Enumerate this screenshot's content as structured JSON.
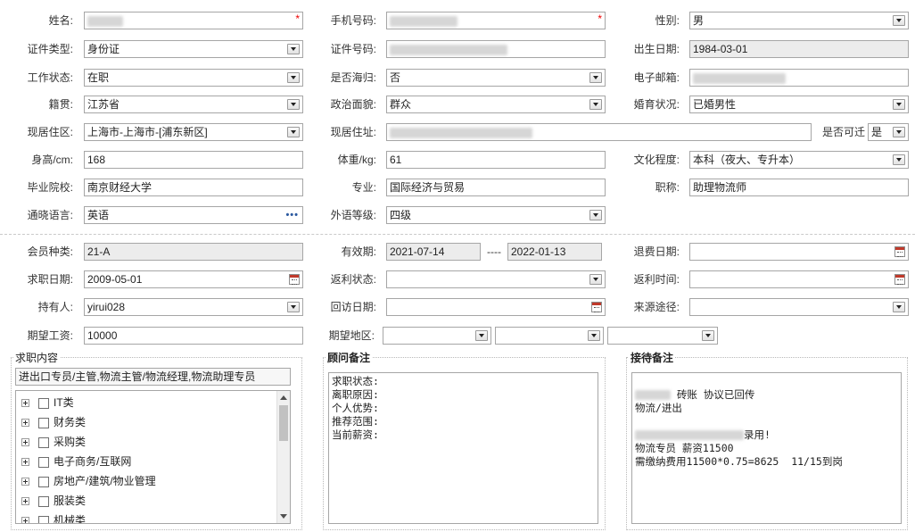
{
  "personal": {
    "name": {
      "label": "姓名:"
    },
    "mobile": {
      "label": "手机号码:"
    },
    "gender": {
      "label": "性别:",
      "value": "男"
    },
    "id_type": {
      "label": "证件类型:",
      "value": "身份证"
    },
    "id_number": {
      "label": "证件号码:"
    },
    "birth_date": {
      "label": "出生日期:",
      "value": "1984-03-01"
    },
    "work_status": {
      "label": "工作状态:",
      "value": "在职"
    },
    "overseas_returnee": {
      "label": "是否海归:",
      "value": "否"
    },
    "email": {
      "label": "电子邮箱:"
    },
    "native_place": {
      "label": "籍贯:",
      "value": "江苏省"
    },
    "political_status": {
      "label": "政治面貌:",
      "value": "群众"
    },
    "marital_status": {
      "label": "婚育状况:",
      "value": "已婚男性"
    },
    "residence_area": {
      "label": "现居住区:",
      "value": "上海市-上海市-[浦东新区]"
    },
    "residence_address": {
      "label": "现居住址:"
    },
    "relocatable": {
      "label": "是否可迁",
      "value": "是"
    },
    "height": {
      "label": "身高/cm:",
      "value": "168"
    },
    "weight": {
      "label": "体重/kg:",
      "value": "61"
    },
    "education": {
      "label": "文化程度:",
      "value": "本科（夜大、专升本）"
    },
    "school": {
      "label": "毕业院校:",
      "value": "南京财经大学"
    },
    "major": {
      "label": "专业:",
      "value": "国际经济与贸易"
    },
    "title": {
      "label": "职称:",
      "value": "助理物流师"
    },
    "languages": {
      "label": "通晓语言:",
      "value": "英语",
      "more": "•••"
    },
    "foreign_level": {
      "label": "外语等级:",
      "value": "四级"
    }
  },
  "membership": {
    "member_type": {
      "label": "会员种类:",
      "value": "21-A"
    },
    "valid_period": {
      "label": "有效期:",
      "from": "2021-07-14",
      "sep": "----",
      "to": "2022-01-13"
    },
    "refund_date": {
      "label": "退费日期:",
      "value": ""
    },
    "job_seek_date": {
      "label": "求职日期:",
      "value": "2009-05-01"
    },
    "rebate_status": {
      "label": "返利状态:",
      "value": ""
    },
    "rebate_time": {
      "label": "返利时间:",
      "value": ""
    },
    "holder": {
      "label": "持有人:",
      "value": "yirui028"
    },
    "revisit_date": {
      "label": "回访日期:",
      "value": ""
    },
    "source": {
      "label": "来源途径:",
      "value": ""
    },
    "expected_salary": {
      "label": "期望工资:",
      "value": "10000"
    },
    "expected_region": {
      "label": "期望地区:"
    }
  },
  "job_intent": {
    "title": "求职内容",
    "selected": "进出口专员/主管,物流主管/物流经理,物流助理专员",
    "categories": [
      "IT类",
      "财务类",
      "采购类",
      "电子商务/互联网",
      "房地产/建筑/物业管理",
      "服装类",
      "机械类"
    ]
  },
  "consultant_notes": {
    "title": "顾问备注",
    "lines": [
      "求职状态:",
      "离职原因:",
      "个人优势:",
      "推荐范围:",
      "当前薪资:"
    ]
  },
  "reception_notes": {
    "title": "接待备注",
    "line1_suffix": "砖账 协议已回传",
    "line2": "物流/进出",
    "line3_suffix": "录用!",
    "line4": "物流专员 薪资11500",
    "line5": "需缴纳费用11500*0.75=8625  11/15到岗"
  },
  "icons": {
    "dropdown": "chevron-down-icon",
    "calendar": "calendar-icon",
    "more": "more-dots-icon",
    "tree_expand": "plus-icon",
    "checkbox": "checkbox-icon"
  },
  "colors": {
    "required": "#e00000",
    "readonly_bg": "#ececec",
    "border": "#a6a6a6",
    "more_dots": "#2c5aa0"
  }
}
